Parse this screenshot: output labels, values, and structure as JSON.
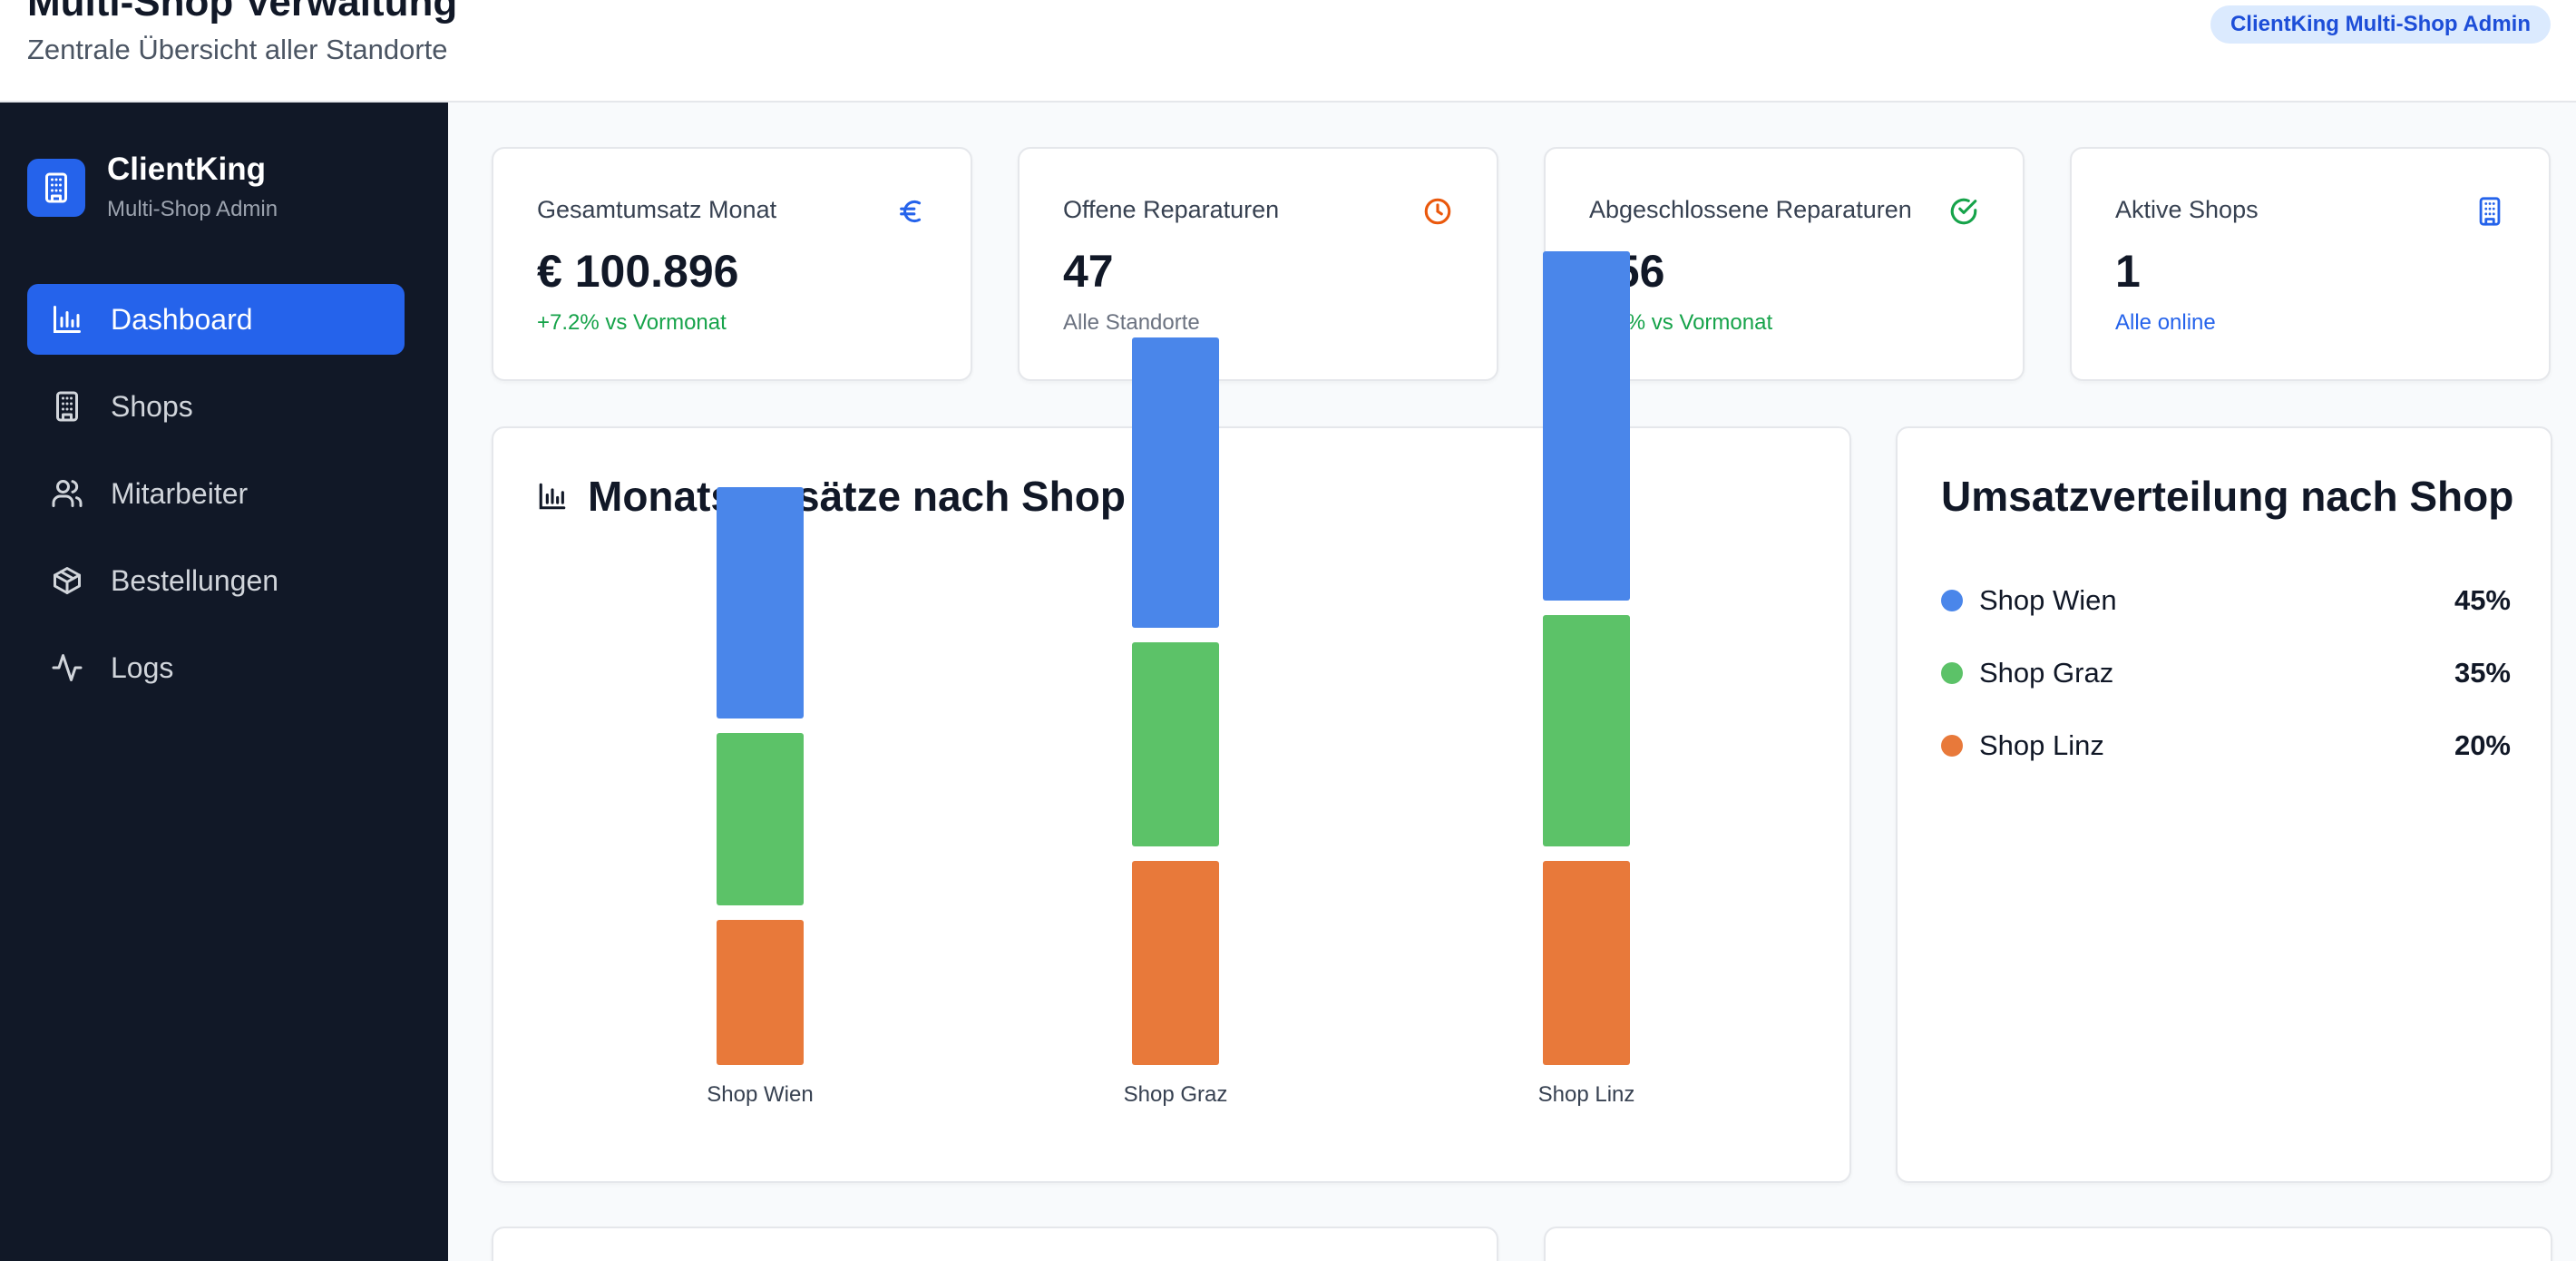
{
  "header": {
    "title": "Multi-Shop Verwaltung",
    "subtitle": "Zentrale Übersicht aller Standorte",
    "badge": "ClientKing Multi-Shop Admin"
  },
  "sidebar": {
    "brand_name": "ClientKing",
    "brand_sub": "Multi-Shop Admin",
    "brand_icon": "building-icon",
    "items": [
      {
        "label": "Dashboard",
        "icon": "bar-chart-icon",
        "active": true
      },
      {
        "label": "Shops",
        "icon": "building-icon",
        "active": false
      },
      {
        "label": "Mitarbeiter",
        "icon": "users-icon",
        "active": false
      },
      {
        "label": "Bestellungen",
        "icon": "package-icon",
        "active": false
      },
      {
        "label": "Logs",
        "icon": "activity-icon",
        "active": false
      }
    ]
  },
  "kpis": [
    {
      "label": "Gesamtumsatz Monat",
      "value": "€ 100.896",
      "note": "+7.2% vs Vormonat",
      "icon": "euro-icon",
      "icon_color": "#2563eb",
      "note_color": "#16a34a"
    },
    {
      "label": "Offene Reparaturen",
      "value": "47",
      "note": "Alle Standorte",
      "icon": "clock-icon",
      "icon_color": "#ea580c",
      "note_color": "#6b7280"
    },
    {
      "label": "Abgeschlossene Reparaturen",
      "value": "156",
      "note": "+12% vs Vormonat",
      "icon": "check-circle-icon",
      "icon_color": "#16a34a",
      "note_color": "#16a34a"
    },
    {
      "label": "Aktive Shops",
      "value": "1",
      "note": "Alle online",
      "icon": "building-icon",
      "icon_color": "#2563eb",
      "note_color": "#2563eb"
    }
  ],
  "bar_chart": {
    "title": "Monatsumsätze nach Shop",
    "icon": "bar-chart-icon"
  },
  "chart_data": {
    "type": "bar",
    "stacked": true,
    "categories": [
      "Shop Wien",
      "Shop Graz",
      "Shop Linz"
    ],
    "series": [
      {
        "values": [
          16,
          22.5,
          22.5
        ],
        "color": "#e8793a"
      },
      {
        "values": [
          19,
          22.5,
          25.5
        ],
        "color": "#5cc268"
      },
      {
        "values": [
          25.5,
          32,
          38.5
        ],
        "color": "#4a86ea"
      }
    ],
    "grid": false,
    "legend": "none"
  },
  "distribution": {
    "title": "Umsatzverteilung nach Shop",
    "items": [
      {
        "name": "Shop Wien",
        "percent": "45%",
        "color": "#4a86ea"
      },
      {
        "name": "Shop Graz",
        "percent": "35%",
        "color": "#5cc268"
      },
      {
        "name": "Shop Linz",
        "percent": "20%",
        "color": "#e8793a"
      }
    ]
  },
  "colors": {
    "sidebar_bg": "#111827",
    "accent": "#2563eb",
    "page_bg": "#f8fafc"
  }
}
